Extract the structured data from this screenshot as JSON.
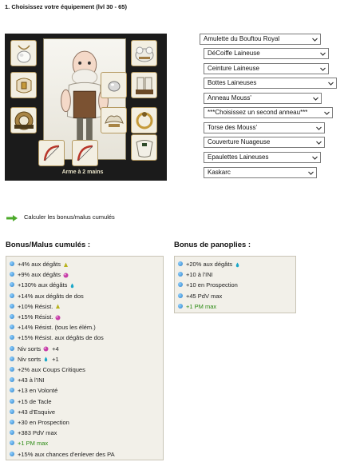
{
  "heading": "1. Choisissez votre équipement (lvl 30 - 65)",
  "equipment": {
    "slots": [
      {
        "name": "amulet-icon"
      },
      {
        "name": "hat-icon"
      },
      {
        "name": "belt-icon"
      },
      {
        "name": "boots-icon"
      },
      {
        "name": "ring-icon"
      },
      {
        "name": "pet-icon"
      },
      {
        "name": "cape-icon"
      },
      {
        "name": "shoulders-icon"
      },
      {
        "name": "shield-icon"
      },
      {
        "name": "ring2-icon"
      }
    ],
    "weapons_label": "Arme à 2 mains"
  },
  "selects": [
    "Amulette du Bouftou Royal",
    "DéCoiffe Laineuse",
    "Ceinture Laineuse",
    "Bottes Laineuses",
    "Anneau Mouss'",
    "***Choisissez un second anneau***",
    "Torse des Mouss'",
    "Couverture Nuageuse",
    "Epaulettes Laineuses",
    "Kaskarc"
  ],
  "calc_link": "Calculer les bonus/malus cumulés",
  "cumulative": {
    "title": "Bonus/Malus cumulés :",
    "items": [
      {
        "text": "+4% aux dégâts",
        "element": "earth",
        "green": false
      },
      {
        "text": "+9% aux dégâts",
        "element": "fire",
        "green": false
      },
      {
        "text": "+130% aux dégâts",
        "element": "water",
        "green": false
      },
      {
        "text": "+14% aux dégâts de dos",
        "element": "",
        "green": false
      },
      {
        "text": "+10% Résist.",
        "element": "earth",
        "green": false
      },
      {
        "text": "+15% Résist.",
        "element": "fire",
        "green": false
      },
      {
        "text": "+14% Résist. (tous les élém.)",
        "element": "",
        "green": false
      },
      {
        "text": "+15% Résist. aux dégâts de dos",
        "element": "",
        "green": false
      },
      {
        "text": "Niv sorts",
        "element": "fire",
        "suffix": "+4",
        "green": false
      },
      {
        "text": "Niv sorts",
        "element": "water",
        "suffix": "+1",
        "green": false
      },
      {
        "text": "+2% aux Coups Critiques",
        "element": "",
        "green": false
      },
      {
        "text": "+43 à l'INI",
        "element": "",
        "green": false
      },
      {
        "text": "+13 en Volonté",
        "element": "",
        "green": false
      },
      {
        "text": "+15 de Tacle",
        "element": "",
        "green": false
      },
      {
        "text": "+43 d'Esquive",
        "element": "",
        "green": false
      },
      {
        "text": "+30 en Prospection",
        "element": "",
        "green": false
      },
      {
        "text": "+383 PdV max",
        "element": "",
        "green": false
      },
      {
        "text": "+1 PM max",
        "element": "",
        "green": true
      },
      {
        "text": "+15% aux chances d'enlever des PA",
        "element": "",
        "green": false
      }
    ]
  },
  "panoplies": {
    "title": "Bonus de panoplies :",
    "items": [
      {
        "text": "+20% aux dégâts",
        "element": "water",
        "green": false
      },
      {
        "text": "+10 à l'INI",
        "element": "",
        "green": false
      },
      {
        "text": "+10 en Prospection",
        "element": "",
        "green": false
      },
      {
        "text": "+45 PdV max",
        "element": "",
        "green": false
      },
      {
        "text": "+1 PM max",
        "element": "",
        "green": true
      }
    ]
  },
  "colors": {
    "earth": "#b8b21c",
    "fire": "#c73ea8",
    "water": "#1aa7c9",
    "green_text": "#2a8a12",
    "panel_bg": "#1b1b1b"
  }
}
